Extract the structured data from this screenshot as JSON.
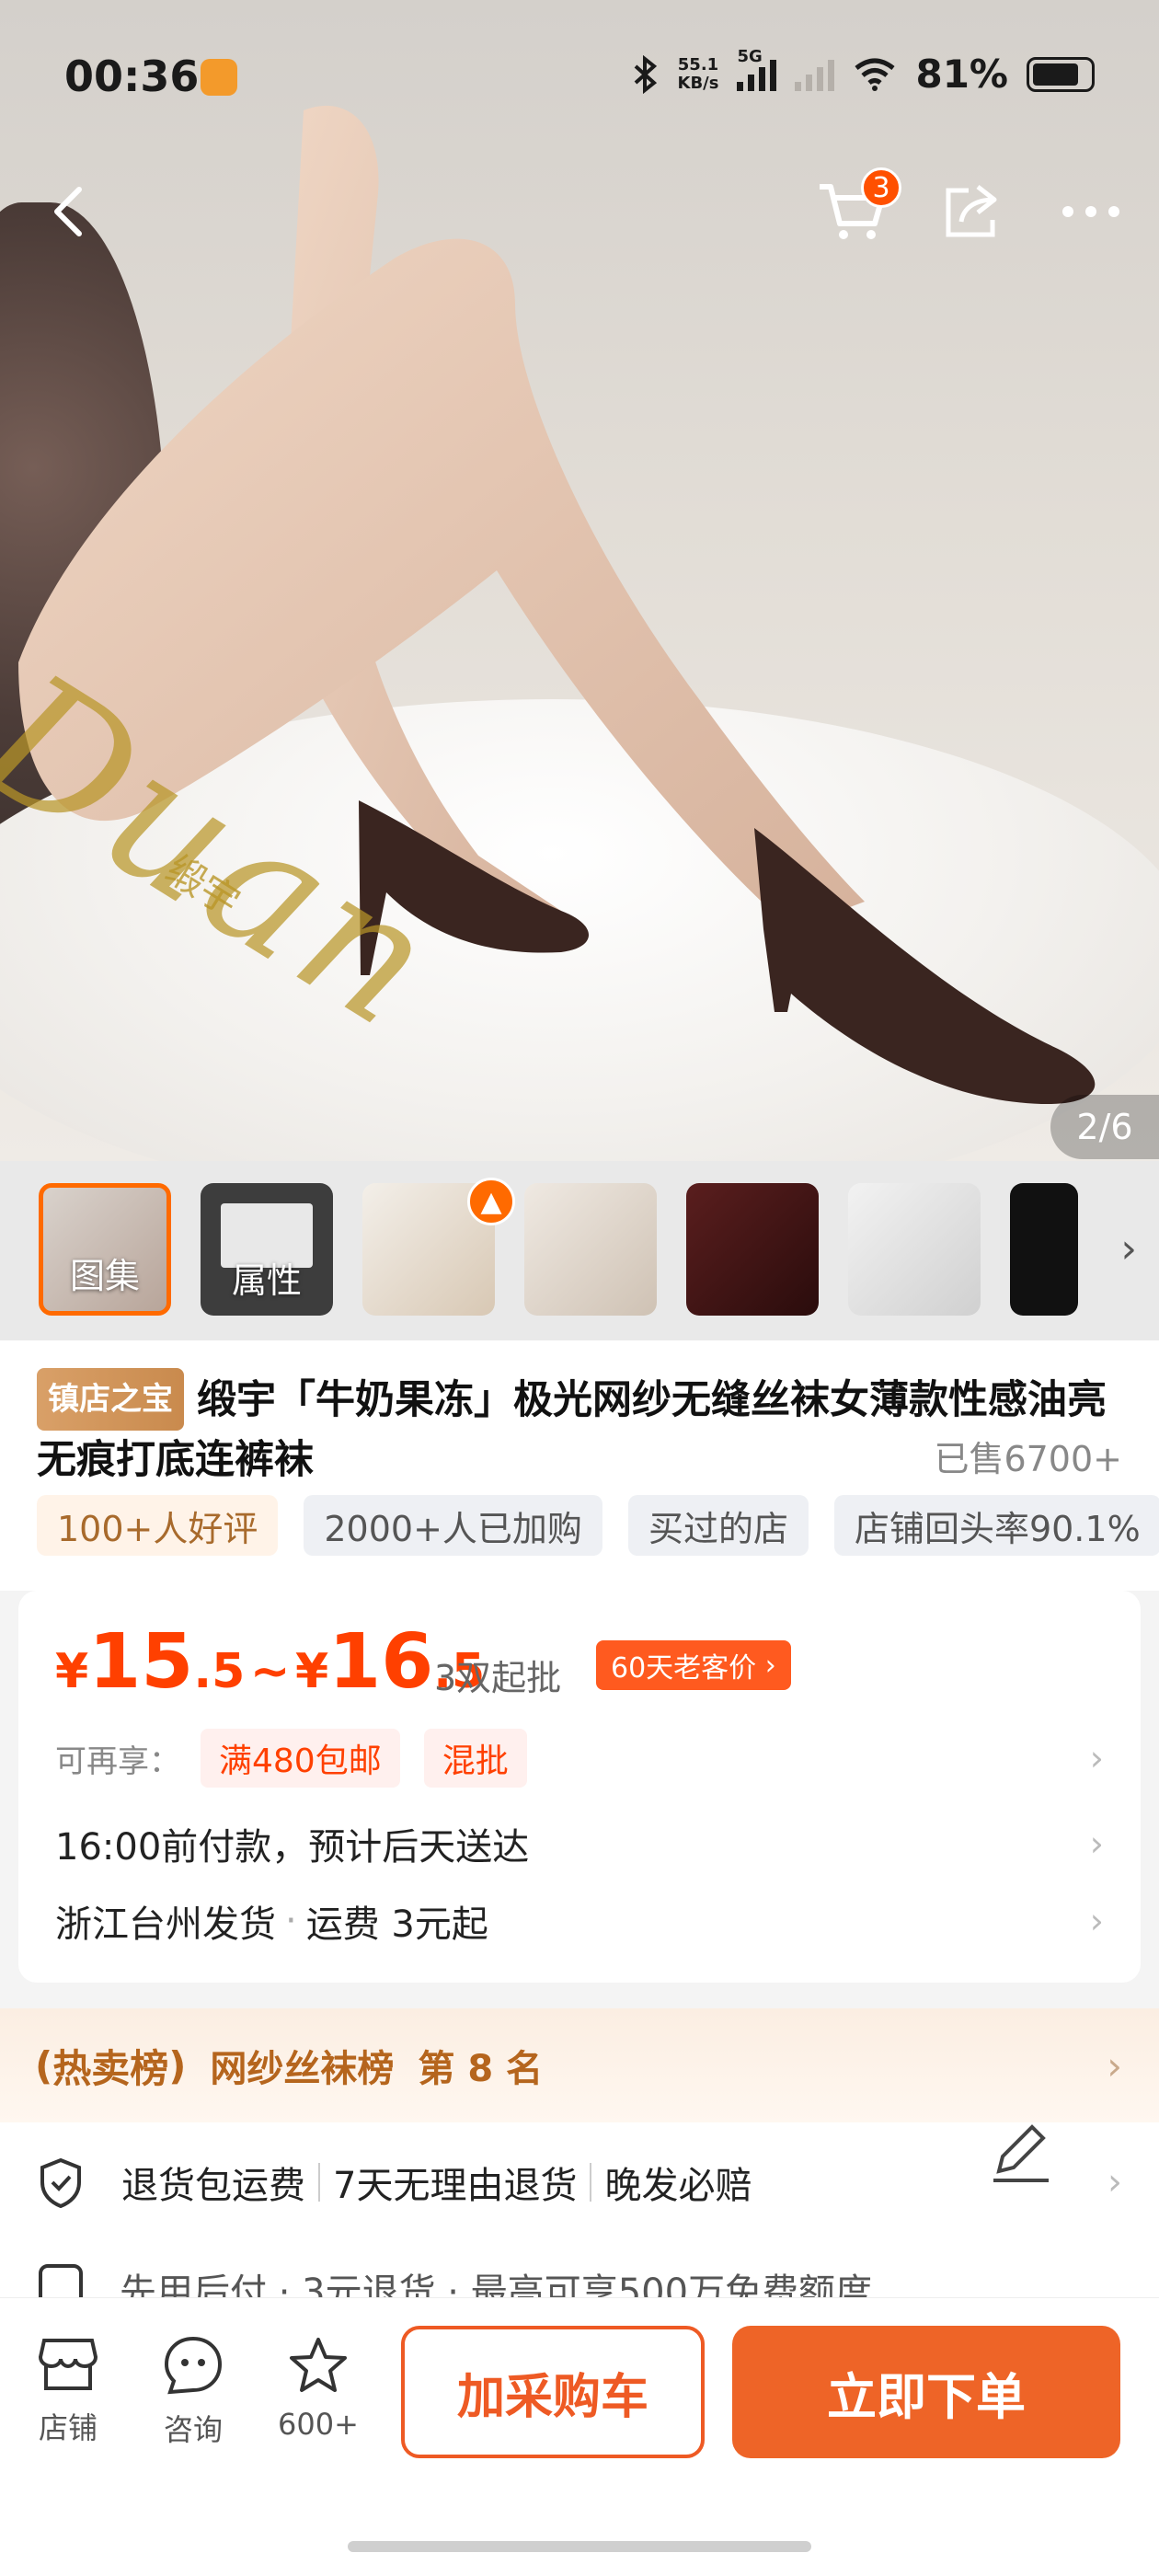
{
  "status_bar": {
    "time": "00:36",
    "net_speed_value": "55.1",
    "net_speed_unit": "KB/s",
    "network": "5G",
    "battery": "81%",
    "battery_level": 0.81
  },
  "nav": {
    "cart_count": "3",
    "icons": [
      "back-icon",
      "cart-icon",
      "share-icon",
      "more-icon"
    ]
  },
  "gallery": {
    "watermark": "Duan",
    "watermark_cn": "缎宇",
    "counter": "2/6",
    "thumbs": [
      {
        "label": "图集"
      },
      {
        "label": "属性"
      },
      {
        "label": ""
      },
      {
        "label": ""
      },
      {
        "label": ""
      },
      {
        "label": ""
      },
      {
        "label": ""
      }
    ]
  },
  "product": {
    "badge": "镇店之宝",
    "title": "缎宇「牛奶果冻」极光网纱无缝丝袜女薄款性感油亮无痕打底连裤袜",
    "sold": "已售6700+",
    "chips": [
      "100+人好评",
      "2000+人已加购",
      "买过的店",
      "店铺回头率90.1%"
    ]
  },
  "price": {
    "yen": "¥",
    "low_int": "15",
    "low_dec": ".5",
    "sep": "~",
    "high_int": "16",
    "high_dec": ".5",
    "min_order": "3双起批",
    "old_customer": "60天老客价",
    "enjoy_label": "可再享：",
    "promos": [
      "满480包邮",
      "混批"
    ],
    "delivery": "16:00前付款，预计后天送达",
    "ship_from": "浙江台州发货",
    "ship_fee": "运费 3元起"
  },
  "rank": {
    "title": "热卖榜",
    "list": "网纱丝袜榜",
    "position": "第 8 名"
  },
  "guarantee": {
    "items": [
      "退货包运费",
      "7天无理由退货",
      "晚发必赔"
    ],
    "partial_text": "先用后付 · 3元退货 · 最高可享500万免费额度"
  },
  "bottom_bar": {
    "shop": "店铺",
    "consult": "咨询",
    "fav_count": "600+",
    "add_cart": "加采购车",
    "buy_now": "立即下单"
  },
  "colors": {
    "accent": "#ee6427",
    "price": "#ff4000"
  }
}
